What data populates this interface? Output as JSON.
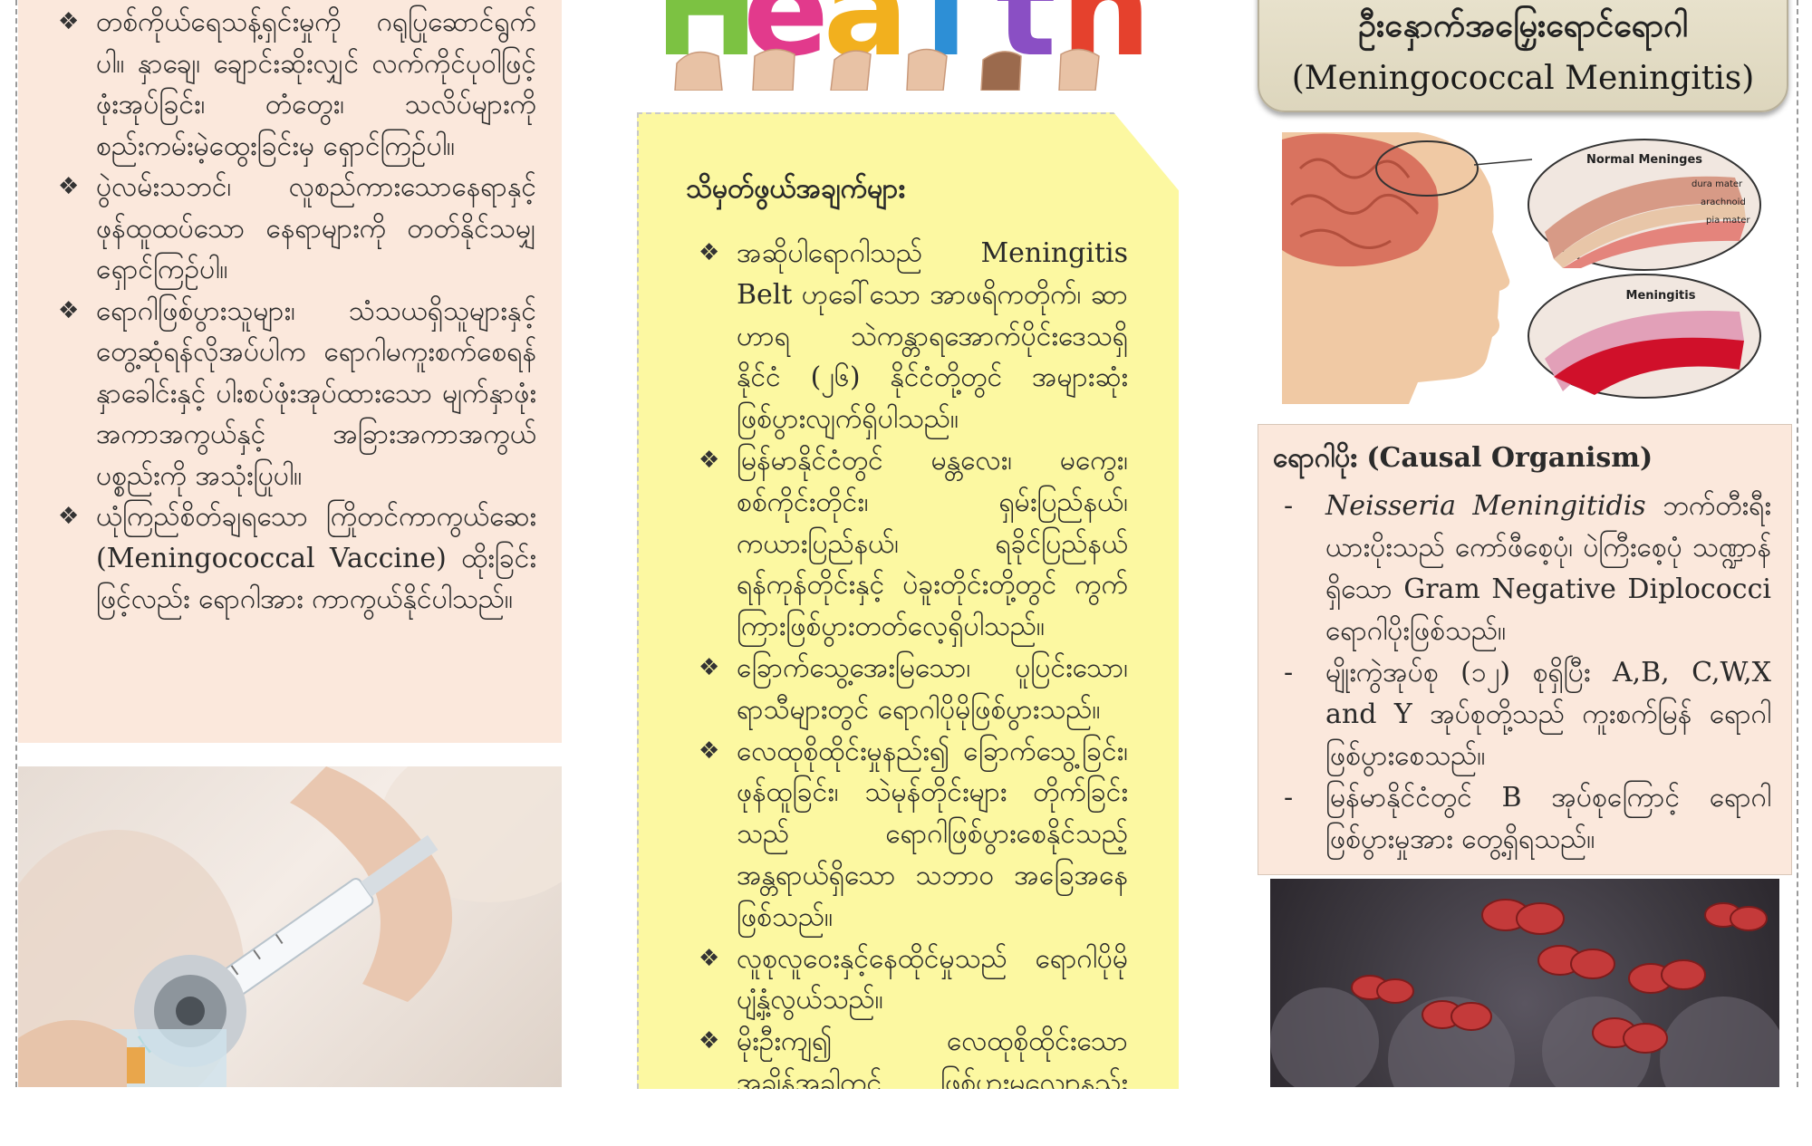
{
  "left": {
    "bullet_symbol": "❖",
    "bullets": [
      "တစ်ကိုယ်ရေသန့်ရှင်းမှုကို ဂရုပြုဆောင်ရွက်ပါ။ နှာချေ၊ ချောင်းဆိုးလျှင် လက်ကိုင်ပုဝါဖြင့် ဖုံးအုပ်ခြင်း၊ တံတွေး၊ သလိပ်များကို စည်းကမ်းမဲ့ထွေးခြင်းမှ ရှောင်ကြဉ်ပါ။",
      "ပွဲလမ်းသဘင်၊ လူစည်ကားသောနေရာနှင့် ဖုန်ထူထပ်သော နေရာများကို တတ်နိုင်သမျှ ရှောင်ကြဉ်ပါ။",
      "ရောဂါဖြစ်ပွားသူများ၊ သံသယရှိသူများနှင့် တွေ့ဆုံရန်လိုအပ်ပါက ရောဂါမကူးစက်စေရန် နှာခေါင်းနှင့် ပါးစပ်ဖုံးအုပ်ထားသော မျက်နှာဖုံး အကာအကွယ်နှင့် အခြားအကာအကွယ်ပစ္စည်းကို အသုံးပြုပါ။",
      "ယုံကြည်စိတ်ချရသော ကြိုတင်ကာကွယ်ဆေး (Meningococcal Vaccine) ထိုးခြင်းဖြင့်လည်း ရောဂါအား ကာကွယ်နိုင်ပါသည်။"
    ]
  },
  "banner": {
    "letters": [
      "H",
      "e",
      "a",
      "l",
      "t",
      "h"
    ],
    "colors": [
      "#7cc242",
      "#e23a8c",
      "#f2b01e",
      "#2d8fd6",
      "#8a4fc4",
      "#e5412d"
    ]
  },
  "middle": {
    "heading": "သိမှတ်ဖွယ်အချက်များ",
    "bullets": [
      "အဆိုပါရောဂါသည် Meningitis Belt ဟုခေါ်သော အာဖရိကတိုက်၊ ဆာဟာရ သဲကန္တာရအောက်ပိုင်းဒေသရှိ နိုင်ငံ (၂၆) နိုင်ငံတို့တွင် အများဆုံးဖြစ်ပွားလျက်ရှိပါသည်။",
      "မြန်မာနိုင်ငံတွင် မန္တလေး၊ မကွေး၊ စစ်ကိုင်းတိုင်း၊ ရှမ်းပြည်နယ်၊ ကယားပြည်နယ်၊ ရခိုင်ပြည်နယ် ရန်ကုန်တိုင်းနှင့် ပဲခူးတိုင်းတို့တွင် ကွက်ကြားဖြစ်ပွားတတ်လေ့ရှိပါသည်။",
      "ခြောက်သွေ့အေးမြသော၊ ပူပြင်းသော၊ ရာသီများတွင် ရောဂါပိုမိုဖြစ်ပွားသည်။",
      "လေထုစိုထိုင်းမှုနည်း၍ ခြောက်သွေ့ခြင်း၊ ဖုန်ထူခြင်း၊ သဲမုန်တိုင်းများ တိုက်ခြင်းသည် ရောဂါဖြစ်ပွားစေနိုင်သည့် အန္တရာယ်ရှိသော သဘာဝ အခြေအနေဖြစ်သည်။",
      "လူစုလူဝေးနှင့်နေထိုင်မှုသည် ရောဂါပိုမို ပျံ့နှံ့လွယ်သည်။",
      "မိုးဦးကျ၍ လေထုစိုထိုင်းသော အချိန်အခါတွင် ဖြစ်ပွားမှုလျော့နည်းသည်။"
    ]
  },
  "right": {
    "title_mm": "ဦးနှောက်အမြှေးရောင်ရောဂါ",
    "title_en": "(Meningococcal Meningitis)",
    "figure_labels": {
      "normal": "Normal Meninges",
      "dura": "dura mater",
      "arachnoid": "arachnoid",
      "pia": "pia mater",
      "meningitis": "Meningitis"
    },
    "causal_heading": "ရောဂါပိုး (Causal Organism)",
    "dash": "-",
    "causal_items": [
      {
        "italic": "Neisseria Meningitidis",
        "text": " ဘက်တီးရီးယားပိုးသည် ကော်ဖီစေ့ပုံ၊ ပဲကြီးစေ့ပုံ သဏ္ဍာန်ရှိသော Gram Negative Diplococci ရောဂါပိုးဖြစ်သည်။"
      },
      {
        "italic": "",
        "text": "မျိုးကွဲအုပ်စု (၁၂) စုရှိပြီး A,B, C,W,X and Y အုပ်စုတို့သည် ကူးစက်မြန် ရောဂါဖြစ်ပွားစေသည်။"
      },
      {
        "italic": "",
        "text": "မြန်မာနိုင်ငံတွင် B အုပ်စုကြောင့် ရောဂါဖြစ်ပွားမှုအား တွေ့ရှိရသည်။"
      }
    ]
  }
}
